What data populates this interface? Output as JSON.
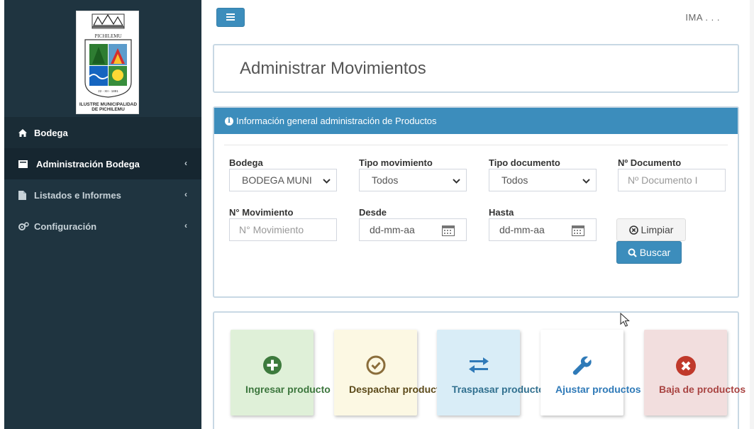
{
  "sidebar": {
    "logo": {
      "top_text": "PICHILEMU",
      "date_text": "22 - XII - 1891",
      "caption_line1": "ILUSTRE MUNICIPALIDAD",
      "caption_line2": "DE PICHILEMU"
    },
    "items": [
      {
        "label": "Bodega",
        "icon": "home-icon"
      },
      {
        "label": "Administración Bodega",
        "icon": "book-icon",
        "chevron": "‹"
      },
      {
        "label": "Listados e Informes",
        "icon": "file-icon",
        "chevron": "‹"
      },
      {
        "label": "Configuración",
        "icon": "cogs-icon",
        "chevron": "‹"
      }
    ]
  },
  "header": {
    "user": "IMA . . ."
  },
  "page": {
    "title": "Administrar Movimientos"
  },
  "panel": {
    "heading": "Información general administración de Productos",
    "fields": {
      "bodega": {
        "label": "Bodega",
        "value": "BODEGA MUNI"
      },
      "tipo_movimiento": {
        "label": "Tipo movimiento",
        "value": "Todos"
      },
      "tipo_documento": {
        "label": "Tipo documento",
        "value": "Todos"
      },
      "numero_documento": {
        "label": "Nº Documento",
        "placeholder": "Nº Documento I"
      },
      "numero_movimiento": {
        "label": "N° Movimiento",
        "placeholder": "N° Movimiento"
      },
      "desde": {
        "label": "Desde",
        "value": "dd-mm-aa"
      },
      "hasta": {
        "label": "Hasta",
        "value": "dd-mm-aa"
      }
    },
    "buttons": {
      "limpiar": "Limpiar",
      "buscar": "Buscar"
    }
  },
  "actions": [
    {
      "label": "Ingresar producto",
      "icon": "plus-circle-icon",
      "bg": "#dff0d8",
      "color": "#3c763d",
      "icon_color": "#3d7a3d"
    },
    {
      "label": "Despachar productos",
      "icon": "check-circle-icon",
      "bg": "#fcf8e3",
      "color": "#5c4a1a",
      "icon_color": "#8a6d3b"
    },
    {
      "label": "Traspasar productos",
      "icon": "exchange-icon",
      "bg": "#d9edf7",
      "color": "#31708f",
      "icon_color": "#2f7ab8"
    },
    {
      "label": "Ajustar productos",
      "icon": "wrench-icon",
      "bg": "#ffffff",
      "color": "#2f7ab8",
      "icon_color": "#2f7ab8"
    },
    {
      "label": "Baja de productos",
      "icon": "times-circle-icon",
      "bg": "#f2dede",
      "color": "#a94442",
      "icon_color": "#c0392b"
    }
  ],
  "colors": {
    "sidebar_bg": "#1f3440",
    "primary": "#3c8dbc",
    "border": "#c8d8e4"
  }
}
